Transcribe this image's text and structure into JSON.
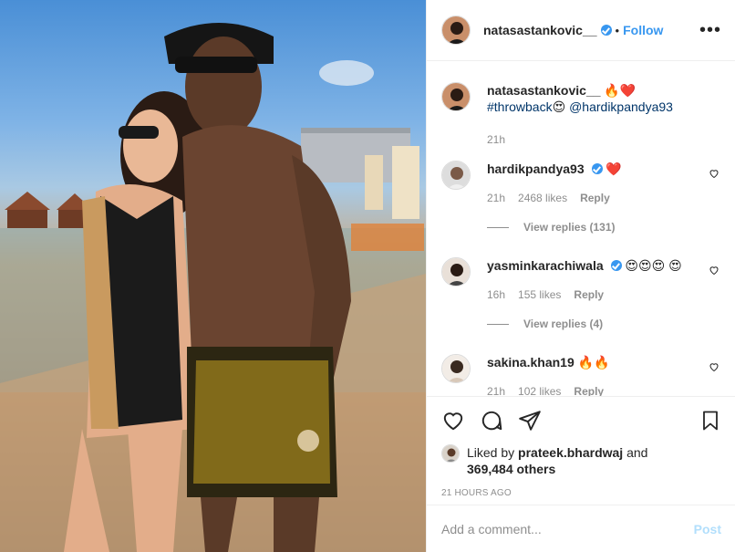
{
  "header": {
    "username": "natasastankovic__",
    "separator": "•",
    "follow_label": "Follow",
    "more_label": "•••"
  },
  "caption": {
    "username": "natasastankovic__",
    "emojis": "🔥❤️",
    "hashtag": "#throwback",
    "emoji_mid": "😍",
    "mention": "@hardikpandya93",
    "time": "21h"
  },
  "comments": [
    {
      "username": "hardikpandya93",
      "verified": true,
      "text": "❤️",
      "time": "21h",
      "likes": "2468 likes",
      "reply_label": "Reply",
      "view_replies": "View replies (131)"
    },
    {
      "username": "yasminkarachiwala",
      "verified": true,
      "text": "😍😍😍 😍",
      "time": "16h",
      "likes": "155 likes",
      "reply_label": "Reply",
      "view_replies": "View replies (4)"
    },
    {
      "username": "sakina.khan19",
      "verified": false,
      "text": "🔥🔥",
      "time": "21h",
      "likes": "102 likes",
      "reply_label": "Reply"
    }
  ],
  "likes": {
    "prefix": "Liked by",
    "user": "prateek.bhardwaj",
    "and": "and",
    "count": "369,484 others"
  },
  "timestamp": "21 HOURS AGO",
  "add_comment": {
    "placeholder": "Add a comment...",
    "post_label": "Post"
  },
  "icons": {
    "like": "heart-icon",
    "comment": "comment-icon",
    "share": "share-icon",
    "save": "bookmark-icon",
    "verified": "verified-badge-icon"
  },
  "colors": {
    "link": "#003569",
    "follow": "#3897f0",
    "muted": "#8e8e8e",
    "post_disabled": "#b2dffc"
  }
}
